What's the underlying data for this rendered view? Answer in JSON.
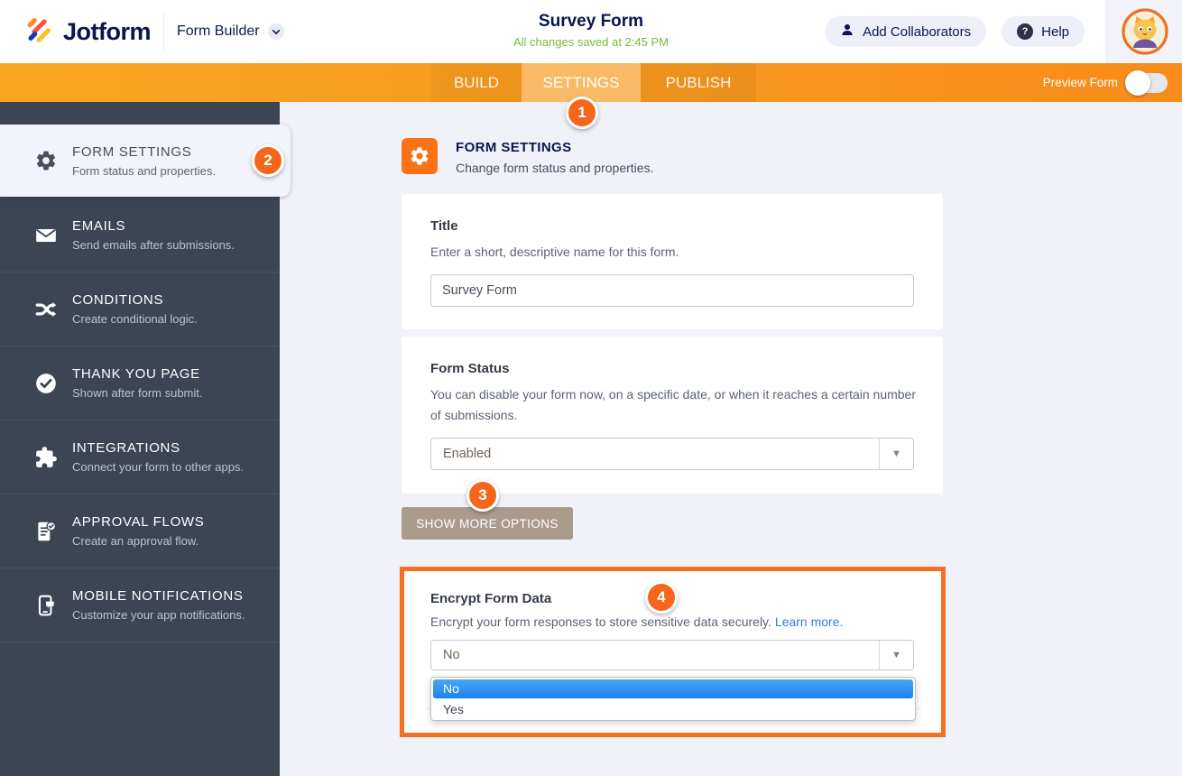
{
  "header": {
    "brand": "Jotform",
    "product": "Form Builder",
    "title": "Survey Form",
    "saved_status": "All changes saved at 2:45 PM",
    "add_collaborators": "Add Collaborators",
    "help": "Help"
  },
  "nav": {
    "tabs": [
      "BUILD",
      "SETTINGS",
      "PUBLISH"
    ],
    "active_tab": "SETTINGS",
    "preview": "Preview Form",
    "preview_toggle_on": false
  },
  "sidebar": {
    "items": [
      {
        "label": "FORM SETTINGS",
        "desc": "Form status and properties.",
        "icon": "gear-icon",
        "active": true
      },
      {
        "label": "EMAILS",
        "desc": "Send emails after submissions.",
        "icon": "envelope-icon",
        "active": false
      },
      {
        "label": "CONDITIONS",
        "desc": "Create conditional logic.",
        "icon": "shuffle-icon",
        "active": false
      },
      {
        "label": "THANK YOU PAGE",
        "desc": "Shown after form submit.",
        "icon": "check-circle-icon",
        "active": false
      },
      {
        "label": "INTEGRATIONS",
        "desc": "Connect your form to other apps.",
        "icon": "puzzle-icon",
        "active": false
      },
      {
        "label": "APPROVAL FLOWS",
        "desc": "Create an approval flow.",
        "icon": "approval-doc-icon",
        "active": false
      },
      {
        "label": "MOBILE NOTIFICATIONS",
        "desc": "Customize your app notifications.",
        "icon": "mobile-phone-icon",
        "active": false
      }
    ]
  },
  "main": {
    "section_title": "FORM SETTINGS",
    "section_desc": "Change form status and properties.",
    "title_card": {
      "label": "Title",
      "desc": "Enter a short, descriptive name for this form.",
      "value": "Survey Form"
    },
    "status_card": {
      "label": "Form Status",
      "desc": "You can disable your form now, on a specific date, or when it reaches a certain number of submissions.",
      "value": "Enabled"
    },
    "show_more": "SHOW MORE OPTIONS",
    "encrypt_card": {
      "label": "Encrypt Form Data",
      "desc": "Encrypt your form responses to store sensitive data securely.",
      "link": "Learn more.",
      "value": "No",
      "options": [
        "No",
        "Yes"
      ],
      "selected_option": "No"
    }
  },
  "annotations": {
    "step1": "1",
    "step2": "2",
    "step3": "3",
    "step4": "4"
  },
  "icons": {
    "header": [
      "jotform-logo",
      "chevron-down-icon",
      "person-icon",
      "question-icon",
      "avatar"
    ],
    "sidebar": [
      "gear-icon",
      "envelope-icon",
      "shuffle-icon",
      "check-circle-icon",
      "puzzle-icon",
      "approval-doc-icon",
      "mobile-phone-icon"
    ],
    "controls": [
      "dropdown-arrow-icon",
      "preview-toggle"
    ]
  },
  "colors": {
    "brand_navy": "#0a1551",
    "nav_orange": "#f89a1e",
    "accent_orange": "#f4701f",
    "sidebar_dark": "#3d4554",
    "saved_green": "#7cb93f",
    "link_blue": "#2f7ddd",
    "highlight_blue": "#2186ea",
    "button_taupe": "#a99b8c"
  }
}
